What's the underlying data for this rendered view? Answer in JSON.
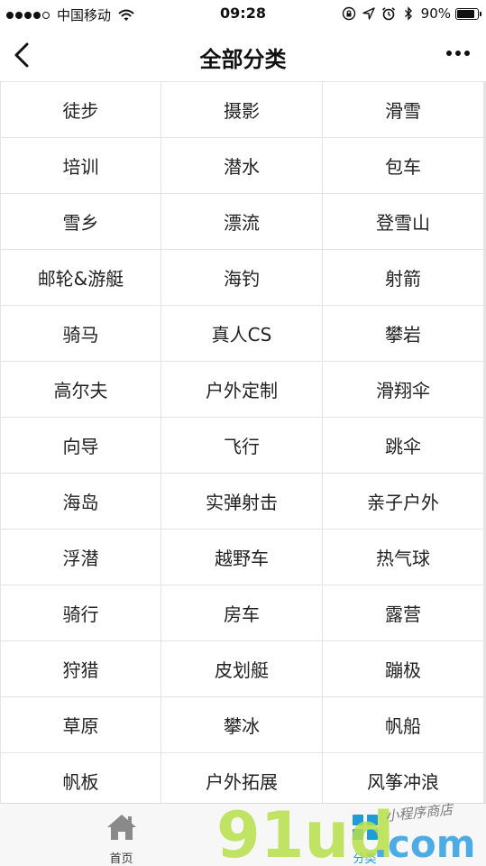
{
  "status_bar": {
    "carrier": "中国移动",
    "time": "09:28",
    "battery_percent": "90%",
    "battery_level": 0.9,
    "signal_strength": 4,
    "icons": [
      "wifi-icon",
      "orientation-lock-icon",
      "location-icon",
      "alarm-icon",
      "bluetooth-icon",
      "battery-icon"
    ]
  },
  "nav": {
    "title": "全部分类",
    "icons": [
      "back-chevron-icon",
      "more-dots-icon"
    ]
  },
  "categories": [
    "徒步",
    "摄影",
    "滑雪",
    "培训",
    "潜水",
    "包车",
    "雪乡",
    "漂流",
    "登雪山",
    "邮轮&游艇",
    "海钓",
    "射箭",
    "骑马",
    "真人CS",
    "攀岩",
    "高尔夫",
    "户外定制",
    "滑翔伞",
    "向导",
    "飞行",
    "跳伞",
    "海岛",
    "实弹射击",
    "亲子户外",
    "浮潜",
    "越野车",
    "热气球",
    "骑行",
    "房车",
    "露营",
    "狩猎",
    "皮划艇",
    "蹦极",
    "草原",
    "攀冰",
    "帆船",
    "帆板",
    "户外拓展",
    "风筝冲浪"
  ],
  "tabs": {
    "home_label": "首页",
    "category_label": "分类",
    "active_color": "#1f9bd8",
    "icons": [
      "home-icon",
      "category-grid-icon"
    ]
  },
  "watermark": {
    "logo_text": "91ud.com",
    "handwritten_text": "小程序商店"
  }
}
